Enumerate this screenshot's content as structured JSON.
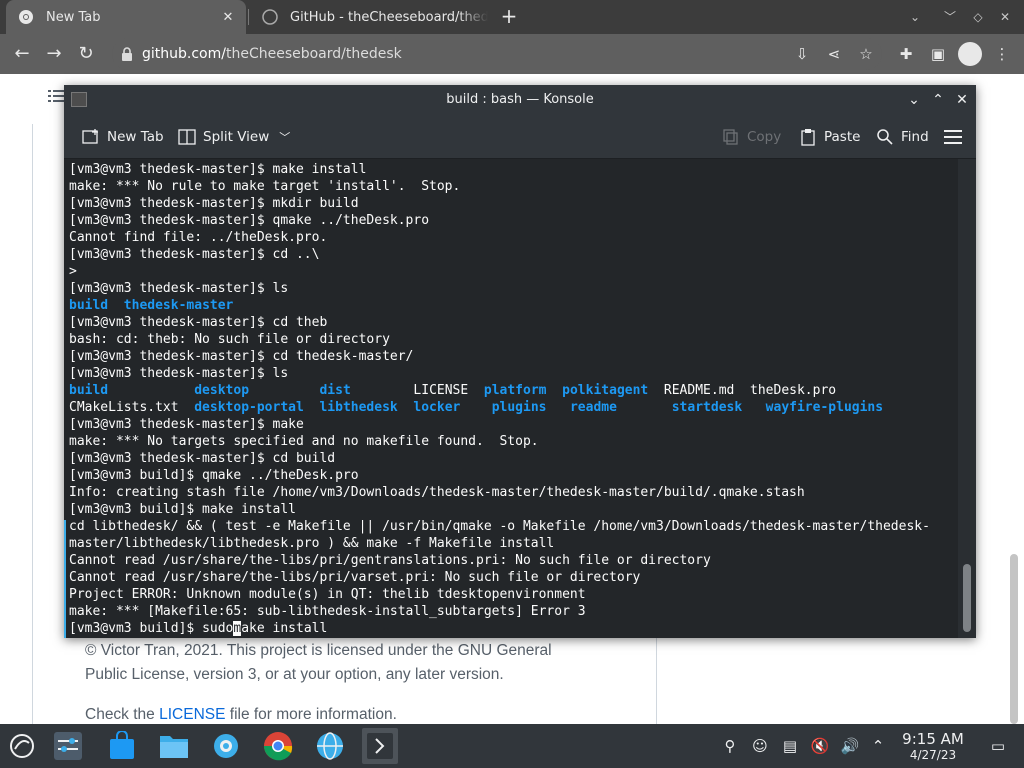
{
  "browser": {
    "tabs": [
      {
        "title": "New Tab",
        "active": true
      },
      {
        "title": "GitHub - theCheeseboard/thedesk",
        "active": false
      }
    ],
    "url_prefix": "github.com/",
    "url_path": "theCheeseboard/thedesk"
  },
  "page": {
    "license_line1": "© Victor Tran, 2021. This project is licensed under the GNU General",
    "license_line2": "Public License, version 3, or at your option, any later version.",
    "check_before": "Check the ",
    "check_link": "LICENSE",
    "check_after": " file for more information."
  },
  "konsole": {
    "title": "build : bash — Konsole",
    "toolbar": {
      "new_tab": "New Tab",
      "split_view": "Split View",
      "copy": "Copy",
      "paste": "Paste",
      "find": "Find"
    },
    "lines": [
      "[vm3@vm3 thedesk-master]$ make install",
      "make: *** No rule to make target 'install'.  Stop.",
      "[vm3@vm3 thedesk-master]$ mkdir build",
      "[vm3@vm3 thedesk-master]$ qmake ../theDesk.pro",
      "Cannot find file: ../theDesk.pro.",
      "[vm3@vm3 thedesk-master]$ cd ..\\",
      ">",
      "[vm3@vm3 thedesk-master]$ ls",
      "",
      "[vm3@vm3 thedesk-master]$ cd theb",
      "bash: cd: theb: No such file or directory",
      "[vm3@vm3 thedesk-master]$ cd thedesk-master/",
      "[vm3@vm3 thedesk-master]$ ls",
      "",
      "",
      "[vm3@vm3 thedesk-master]$ make",
      "make: *** No targets specified and no makefile found.  Stop.",
      "[vm3@vm3 thedesk-master]$ cd build",
      "[vm3@vm3 build]$ qmake ../theDesk.pro",
      "Info: creating stash file /home/vm3/Downloads/thedesk-master/thedesk-master/build/.qmake.stash",
      "[vm3@vm3 build]$ make install",
      "cd libthedesk/ && ( test -e Makefile || /usr/bin/qmake -o Makefile /home/vm3/Downloads/thedesk-master/thedesk-",
      "master/libthedesk/libthedesk.pro ) && make -f Makefile install",
      "Cannot read /usr/share/the-libs/pri/gentranslations.pri: No such file or directory",
      "Cannot read /usr/share/the-libs/pri/varset.pri: No such file or directory",
      "Project ERROR: Unknown module(s) in QT: thelib tdesktopenvironment",
      "make: *** [Makefile:65: sub-libthedesk-install_subtargets] Error 3"
    ],
    "ls1": [
      "build",
      "thedesk-master"
    ],
    "ls2_row1": [
      "build",
      "desktop",
      "dist",
      "LICENSE",
      "platform",
      "polkitagent",
      "README.md",
      "theDesk.pro"
    ],
    "ls2_row2": [
      "CMakeLists.txt",
      "desktop-portal",
      "libthedesk",
      "locker",
      "plugins",
      "readme",
      "startdesk",
      "wayfire-plugins"
    ],
    "prompt_last": "[vm3@vm3 build]$ ",
    "typed_before_cursor": "sudo",
    "cursor_char": "m",
    "typed_after_cursor": "ake install"
  },
  "taskbar": {
    "time": "9:15 AM",
    "date": "4/27/23"
  },
  "colors": {
    "dir": "#1d99f3",
    "terminal_bg": "#232629",
    "terminal_fg": "#fcfcfc",
    "accent": "#3daee9"
  }
}
